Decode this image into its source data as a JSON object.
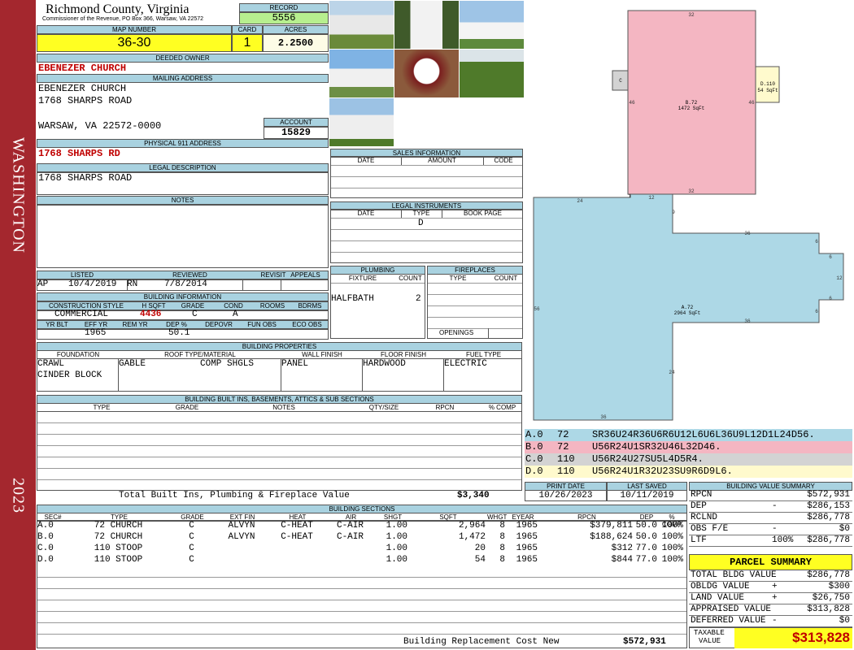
{
  "sidebar": {
    "location": "WASHINGTON",
    "year": "2023"
  },
  "header": {
    "county": "Richmond County, Virginia",
    "address": "Commissioner of the Revenue, PO Box 366, Warsaw, VA 22572",
    "record_label": "RECORD",
    "record": "5556",
    "map_label": "MAP NUMBER",
    "map_number": "36-30",
    "card_label": "CARD",
    "card": "1",
    "acres_label": "ACRES",
    "acres": "2.2500"
  },
  "owner": {
    "label": "DEEDED OWNER",
    "name": "EBENEZER CHURCH",
    "mailing_label": "MAILING ADDRESS",
    "mail1": "EBENEZER CHURCH",
    "mail2": "1768 SHARPS ROAD",
    "mail3": "WARSAW, VA 22572-0000",
    "account_label": "ACCOUNT",
    "account": "15829",
    "physical_label": "PHYSICAL 911 ADDRESS",
    "physical": "1768 SHARPS RD",
    "legal_label": "LEGAL DESCRIPTION",
    "legal": "1768 SHARPS ROAD",
    "notes_label": "NOTES"
  },
  "sales": {
    "label": "SALES INFORMATION",
    "cols": [
      "DATE",
      "AMOUNT",
      "CODE"
    ]
  },
  "legal_instr": {
    "label": "LEGAL INSTRUMENTS",
    "cols": [
      "DATE",
      "TYPE",
      "BOOK PAGE"
    ],
    "type": "D"
  },
  "listing": {
    "cols": [
      "LISTED",
      "REVIEWED",
      "REVISIT",
      "APPEALS"
    ],
    "listed_by": "AP",
    "listed": "10/4/2019",
    "reviewed_by": "RN",
    "reviewed": "7/8/2014"
  },
  "plumbing": {
    "label": "PLUMBING",
    "cols": [
      "FIXTURE",
      "COUNT"
    ],
    "fixture": "HALFBATH",
    "count": "2"
  },
  "fireplaces": {
    "label": "FIREPLACES",
    "cols": [
      "TYPE",
      "COUNT"
    ],
    "openings": "OPENINGS"
  },
  "building_info": {
    "label": "BUILDING INFORMATION",
    "cols": [
      "CONSTRUCTION STYLE",
      "H SQFT",
      "GRADE",
      "COND",
      "ROOMS",
      "BDRMS"
    ],
    "style": "COMMERCIAL",
    "sqft": "4436",
    "grade": "C",
    "cond": "A",
    "cols2": [
      "YR BLT",
      "EFF YR",
      "REM YR",
      "DEP %",
      "DEPOVR",
      "FUN OBS",
      "ECO OBS"
    ],
    "eff_yr": "1965",
    "dep": "50.1"
  },
  "properties": {
    "label": "BUILDING PROPERTIES",
    "cols": [
      "FOUNDATION",
      "ROOF TYPE/MATERIAL",
      "WALL FINISH",
      "FLOOR FINISH",
      "FUEL TYPE"
    ],
    "foundation1": "CRAWL",
    "foundation2": "CINDER BLOCK",
    "roof_type": "GABLE",
    "roof_mat": "COMP SHGLS",
    "wall": "PANEL",
    "floor": "HARDWOOD",
    "fuel": "ELECTRIC"
  },
  "builtins": {
    "label": "BUILDING BUILT INS, BASEMENTS, ATTICS & SUB SECTIONS",
    "cols": [
      "TYPE",
      "GRADE",
      "NOTES",
      "QTY/SIZE",
      "RPCN",
      "% COMP"
    ],
    "total_label": "Total Built Ins, Plumbing & Fireplace Value",
    "total": "$3,340"
  },
  "dates": {
    "print_label": "PRINT DATE",
    "print": "10/26/2023",
    "saved_label": "LAST SAVED",
    "saved": "10/11/2019"
  },
  "sections": {
    "label": "BUILDING SECTIONS",
    "cols": [
      "SEC#",
      "TYPE",
      "GRADE",
      "EXT FIN",
      "HEAT",
      "AIR",
      "SHGT",
      "SQFT",
      "WHGT",
      "EYEAR",
      "RPCN",
      "DEP",
      "% COMP"
    ],
    "rows": [
      [
        "A.0",
        "72 CHURCH",
        "C",
        "ALVYN",
        "C-HEAT",
        "C-AIR",
        "1.00",
        "2,964",
        "8",
        "1965",
        "$379,811",
        "50.0",
        "100%"
      ],
      [
        "B.0",
        "72 CHURCH",
        "C",
        "ALVYN",
        "C-HEAT",
        "C-AIR",
        "1.00",
        "1,472",
        "8",
        "1965",
        "$188,624",
        "50.0",
        "100%"
      ],
      [
        "C.0",
        "110 STOOP",
        "C",
        "",
        "",
        "",
        "1.00",
        "20",
        "8",
        "1965",
        "$312",
        "77.0",
        "100%"
      ],
      [
        "D.0",
        "110 STOOP",
        "C",
        "",
        "",
        "",
        "1.00",
        "54",
        "8",
        "1965",
        "$844",
        "77.0",
        "100%"
      ]
    ],
    "total_label": "Building Replacement Cost New",
    "total": "$572,931"
  },
  "value_summary": {
    "label": "BUILDING VALUE SUMMARY",
    "rows": [
      {
        "l": "RPCN",
        "s": "",
        "v": "$572,931"
      },
      {
        "l": "DEP",
        "s": "-",
        "v": "$286,153"
      },
      {
        "l": "RCLND",
        "s": "",
        "v": "$286,778"
      },
      {
        "l": "OBS F/E",
        "s": "-",
        "v": "$0"
      },
      {
        "l": "LTF",
        "s": "100%",
        "v": "$286,778"
      }
    ]
  },
  "parcel": {
    "label": "PARCEL SUMMARY",
    "rows": [
      {
        "l": "TOTAL BLDG VALUE",
        "s": "",
        "v": "$286,778"
      },
      {
        "l": "OBLDG VALUE",
        "s": "+",
        "v": "$300"
      },
      {
        "l": "LAND VALUE",
        "s": "+",
        "v": "$26,750"
      },
      {
        "l": "APPRAISED VALUE",
        "s": "",
        "v": "$313,828"
      },
      {
        "l": "DEFERRED VALUE",
        "s": "-",
        "v": "$0"
      }
    ],
    "taxable_label1": "TAXABLE",
    "taxable_label2": "VALUE",
    "taxable": "$313,828"
  },
  "segments": [
    {
      "id": "A.0",
      "code": "72",
      "path": "SR36U24R36U6R6U12L6U6L36U9L12D1L24D56.",
      "color": "#add8e6"
    },
    {
      "id": "B.0",
      "code": "72",
      "path": "U56R24U1SR32U46L32D46.",
      "color": "#f4b6c2"
    },
    {
      "id": "C.0",
      "code": "110",
      "path": "U56R24U27SU5L4D5R4.",
      "color": "#d3d3d3"
    },
    {
      "id": "D.0",
      "code": "110",
      "path": "U56R24U1R32U23SU9R6D9L6.",
      "color": "#fffacd"
    }
  ],
  "sketch": {
    "b_label": "B.72",
    "b_area": "1472 SqFt",
    "a_label": "A.72",
    "a_area": "2964 SqFt",
    "d_label": "D.110",
    "d_area": "54 SqFt",
    "c_label": "C",
    "dims": {
      "b_top": "32",
      "b_left": "46",
      "b_right": "46",
      "b_bottom": "32",
      "a_24": "24",
      "a_1": "1",
      "a_12": "12",
      "a_9": "9",
      "a_36t": "36",
      "a_6a": "6",
      "a_6b": "6",
      "a_12r": "12",
      "a_6c": "6",
      "a_6d": "6",
      "a_36m": "36",
      "a_56": "56",
      "a_24v": "24",
      "a_36b": "36"
    }
  },
  "colors": {
    "header_blue": "#a9d2e0",
    "sidebar": "#a4272e",
    "record_green": "#b7ef8f",
    "yellow": "#ffff22",
    "value_red": "#c00000"
  }
}
